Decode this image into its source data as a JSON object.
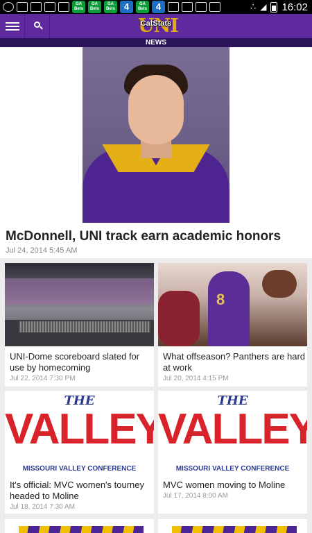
{
  "status_bar": {
    "apps": [
      "GA Bets",
      "GA Bets",
      "GA Bets"
    ],
    "channel_badge": "4",
    "time": "16:02"
  },
  "app_bar": {
    "logo_text": "UNI",
    "logo_overlay": "CatStats",
    "section": "NEWS"
  },
  "hero": {
    "title": "McDonnell, UNI track earn academic honors",
    "date": "Jul 24, 2014 5:45 AM"
  },
  "articles": [
    {
      "title": "UNI-Dome scoreboard slated for use by homecoming",
      "date": "Jul 22, 2014 7:30 PM"
    },
    {
      "title": "What offseason? Panthers are hard at work",
      "date": "Jul 20, 2014 4:15 PM"
    },
    {
      "title": "It's official: MVC women's tourney headed to Moline",
      "date": "Jul 18, 2014 7:30 AM"
    },
    {
      "title": "MVC women moving to Moline",
      "date": "Jul 17, 2014 8:00 AM"
    }
  ],
  "valley_logo": {
    "the": "THE",
    "valley": "VALLEY",
    "conference": "MISSOURI VALLEY CONFERENCE"
  },
  "colors": {
    "app_bar": "#5e2a9e",
    "sub_bar": "#2b1457",
    "gold": "#f4b800"
  }
}
